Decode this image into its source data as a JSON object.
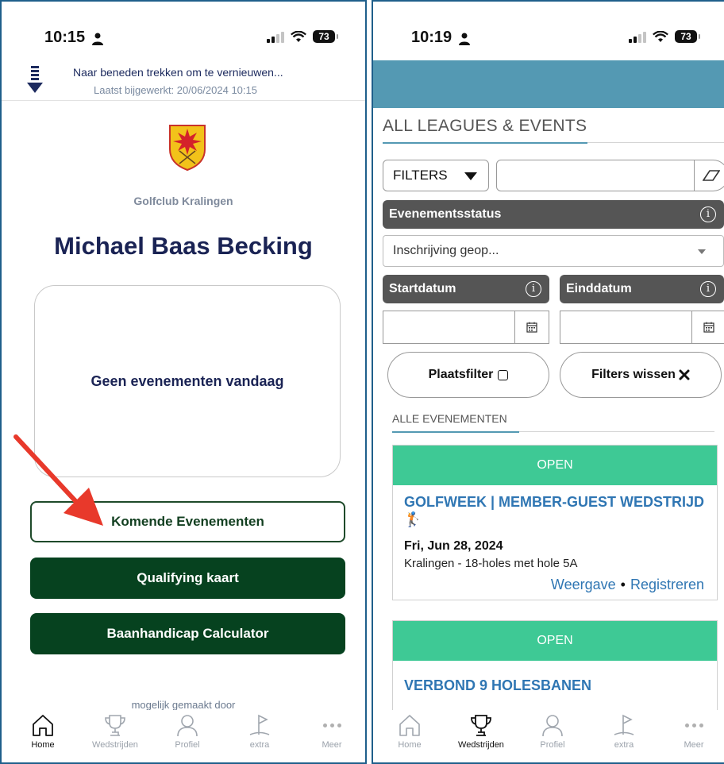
{
  "left": {
    "status": {
      "time": "10:15",
      "battery": "73"
    },
    "refresh": {
      "title": "Naar beneden trekken om te vernieuwen...",
      "updated": "Laatst bijgewerkt: 20/06/2024 10:15"
    },
    "club_name": "Golfclub Kralingen",
    "user_name": "Michael Baas Becking",
    "no_events": "Geen evenementen vandaag",
    "buttons": {
      "upcoming": "Komende Evenementen",
      "qualifying": "Qualifying kaart",
      "handicap": "Baanhandicap Calculator"
    },
    "powered_by": "mogelijk gemaakt door",
    "tabs": [
      "Home",
      "Wedstrijden",
      "Profiel",
      "extra",
      "Meer"
    ],
    "active_tab": "Home"
  },
  "right": {
    "status": {
      "time": "10:19",
      "battery": "73"
    },
    "header_color": "#5499b3",
    "section_title": "ALL LEAGUES & EVENTS",
    "filters_label": "FILTERS",
    "search_value": "",
    "event_status_label": "Evenementsstatus",
    "event_status_value": "Inschrijving geop...",
    "start_label": "Startdatum",
    "end_label": "Einddatum",
    "start_value": "",
    "end_value": "",
    "location_filter": "Plaatsfilter",
    "clear_filters": "Filters wissen",
    "all_events": "ALLE EVENEMENTEN",
    "events": [
      {
        "status": "OPEN",
        "title": "GOLFWEEK | MEMBER-GUEST WEDSTRIJD",
        "emoji": "🏌",
        "date": "Fri, Jun 28, 2024",
        "location": "Kralingen - 18-holes met hole 5A",
        "view": "Weergave",
        "register": "Registreren"
      },
      {
        "status": "OPEN",
        "title": "VERBOND 9 HOLESBANEN"
      }
    ],
    "tabs": [
      "Home",
      "Wedstrijden",
      "Profiel",
      "extra",
      "Meer"
    ],
    "active_tab": "Wedstrijden"
  }
}
